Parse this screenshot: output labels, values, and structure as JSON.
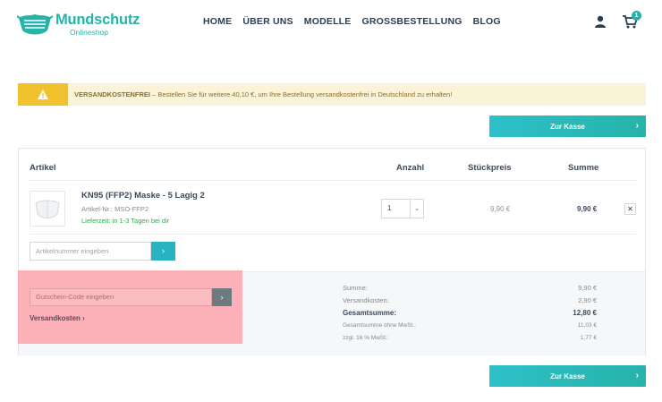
{
  "header": {
    "logo_title": "Mundschutz",
    "logo_subtitle": "Onlineshop",
    "nav": [
      "HOME",
      "ÜBER UNS",
      "MODELLE",
      "GROSSBESTELLUNG",
      "BLOG"
    ],
    "cart_count": "1"
  },
  "notice": {
    "title": "VERSANDKOSTENFREI",
    "text": " – Bestellen Sie für weitere 40,10 €, um Ihre Bestellung versandkostenfrei in Deutschland zu erhalten!"
  },
  "checkout_label": "Zur Kasse",
  "table": {
    "headers": {
      "article": "Artikel",
      "quantity": "Anzahl",
      "unit_price": "Stückpreis",
      "total": "Summe"
    }
  },
  "item": {
    "name": "KN95 (FFP2) Maske - 5 Lagig 2",
    "sku": "Artikel-Nr.: MSO-FFP2",
    "delivery": "Lieferzeit: in 1-3 Tagen bei dir",
    "quantity": "1",
    "unit_price": "9,90 €",
    "total": "9,90 €"
  },
  "sku_input": {
    "placeholder": "Artikelnummer eingeben"
  },
  "coupon": {
    "placeholder": "Gutschein-Code eingeben",
    "shipping_link": "Versandkosten ›"
  },
  "summary": [
    {
      "label": "Summe:",
      "value": "9,90 €",
      "style": "normal"
    },
    {
      "label": "Versandkosten:",
      "value": "2,90 €",
      "style": "normal"
    },
    {
      "label": "Gesamtsumme:",
      "value": "12,80 €",
      "style": "bold"
    },
    {
      "label": "Gesamtsumme ohne MwSt.:",
      "value": "11,03 €",
      "style": "small"
    },
    {
      "label": "zzgl. 16 % MwSt.:",
      "value": "1,77 €",
      "style": "small"
    }
  ],
  "colors": {
    "accent": "#27b3a9",
    "warning": "#f2c12e",
    "highlight": "#ff7882"
  }
}
